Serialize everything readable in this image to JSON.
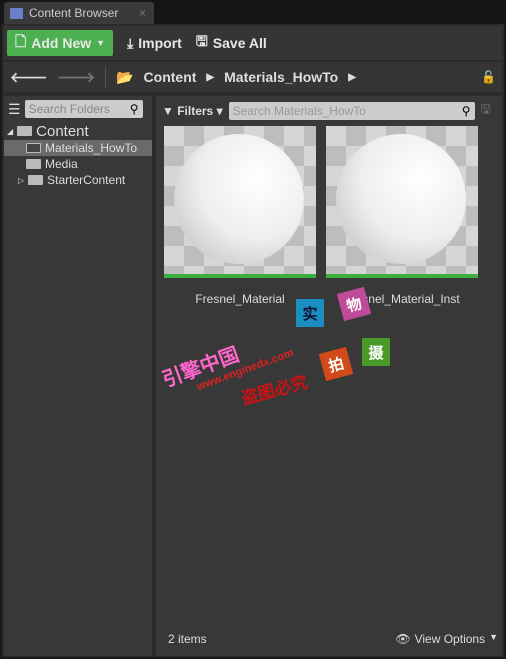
{
  "tab": {
    "title": "Content Browser",
    "close": "×"
  },
  "toolbar": {
    "add_new": "Add New",
    "import": "Import",
    "save_all": "Save All"
  },
  "nav": {
    "path": [
      "Content",
      "Materials_HowTo"
    ]
  },
  "sidebar": {
    "search_placeholder": "Search Folders",
    "tree": [
      {
        "label": "Content",
        "expanded": true
      },
      {
        "label": "Materials_HowTo",
        "selected": true
      },
      {
        "label": "Media"
      },
      {
        "label": "StarterContent",
        "expandable": true
      }
    ]
  },
  "main": {
    "filters": "Filters",
    "search_placeholder": "Search Materials_HowTo",
    "assets": [
      {
        "name": "Fresnel_Material"
      },
      {
        "name": "Fresnel_Material_Inst"
      }
    ],
    "item_count": "2 items",
    "view_options": "View Options"
  },
  "watermark": {
    "site": "www.enginedx.com",
    "brand": "引擎中国",
    "notice": "盗图必究",
    "chars": [
      "实",
      "物",
      "拍",
      "摄"
    ]
  },
  "colors": {
    "accent": "#4caf50",
    "asset_bar": "#3caf3c"
  }
}
